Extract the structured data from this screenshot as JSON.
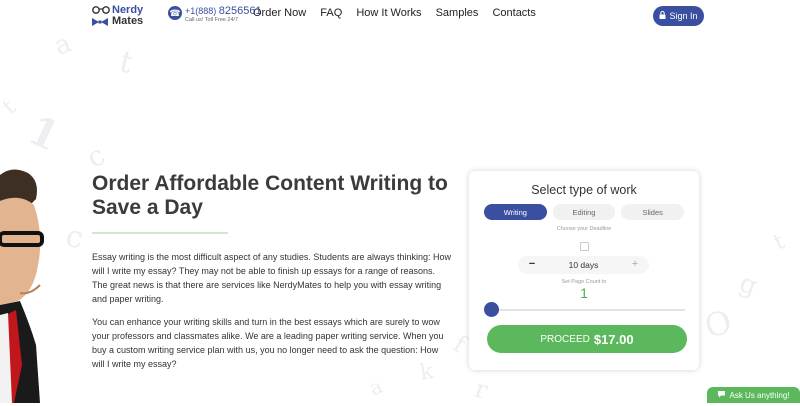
{
  "header": {
    "logo": {
      "line1": "Nerdy",
      "line2": "Mates"
    },
    "phone": {
      "prefix": "+1(888)",
      "number": "8256561",
      "note": "Call us! Toll Free 24/7"
    },
    "nav": [
      "Order Now",
      "FAQ",
      "How It Works",
      "Samples",
      "Contacts"
    ],
    "signin_label": "Sign In"
  },
  "main": {
    "title": "Order Affordable Content Writing to Save a Day",
    "paragraphs": [
      "Essay writing is the most difficult aspect of any studies. Students are always thinking: How will I write my essay? They may not be able to finish up essays for a range of reasons. The great news is that there are services like NerdyMates to help you with essay writing and paper writing.",
      "You can enhance your writing skills and turn in the best essays which are surely to wow your professors and classmates alike. We are a leading paper writing service. When you buy a custom writing service plan with us, you no longer need to ask the question: How will I write my essay?"
    ]
  },
  "order_card": {
    "title": "Select type of work",
    "tabs": [
      {
        "label": "Writing",
        "active": true
      },
      {
        "label": "Editing",
        "active": false
      },
      {
        "label": "Slides",
        "active": false
      }
    ],
    "deadline_label": "Choose your Deadline",
    "deadline_value": "10 days",
    "minus": "−",
    "plus": "+",
    "pages_label": "Set Page Count to",
    "pages_value": "1",
    "slider_fraction": 0.0,
    "proceed_label": "PROCEED",
    "price": "$17.00"
  },
  "chat": {
    "label": "Ask Us anything!"
  },
  "colors": {
    "brand": "#3a4fa0",
    "accent": "#5cb85c",
    "text": "#333333"
  },
  "icons": [
    "glasses-icon",
    "phone-icon",
    "lock-icon",
    "calendar-icon",
    "chat-icon"
  ]
}
